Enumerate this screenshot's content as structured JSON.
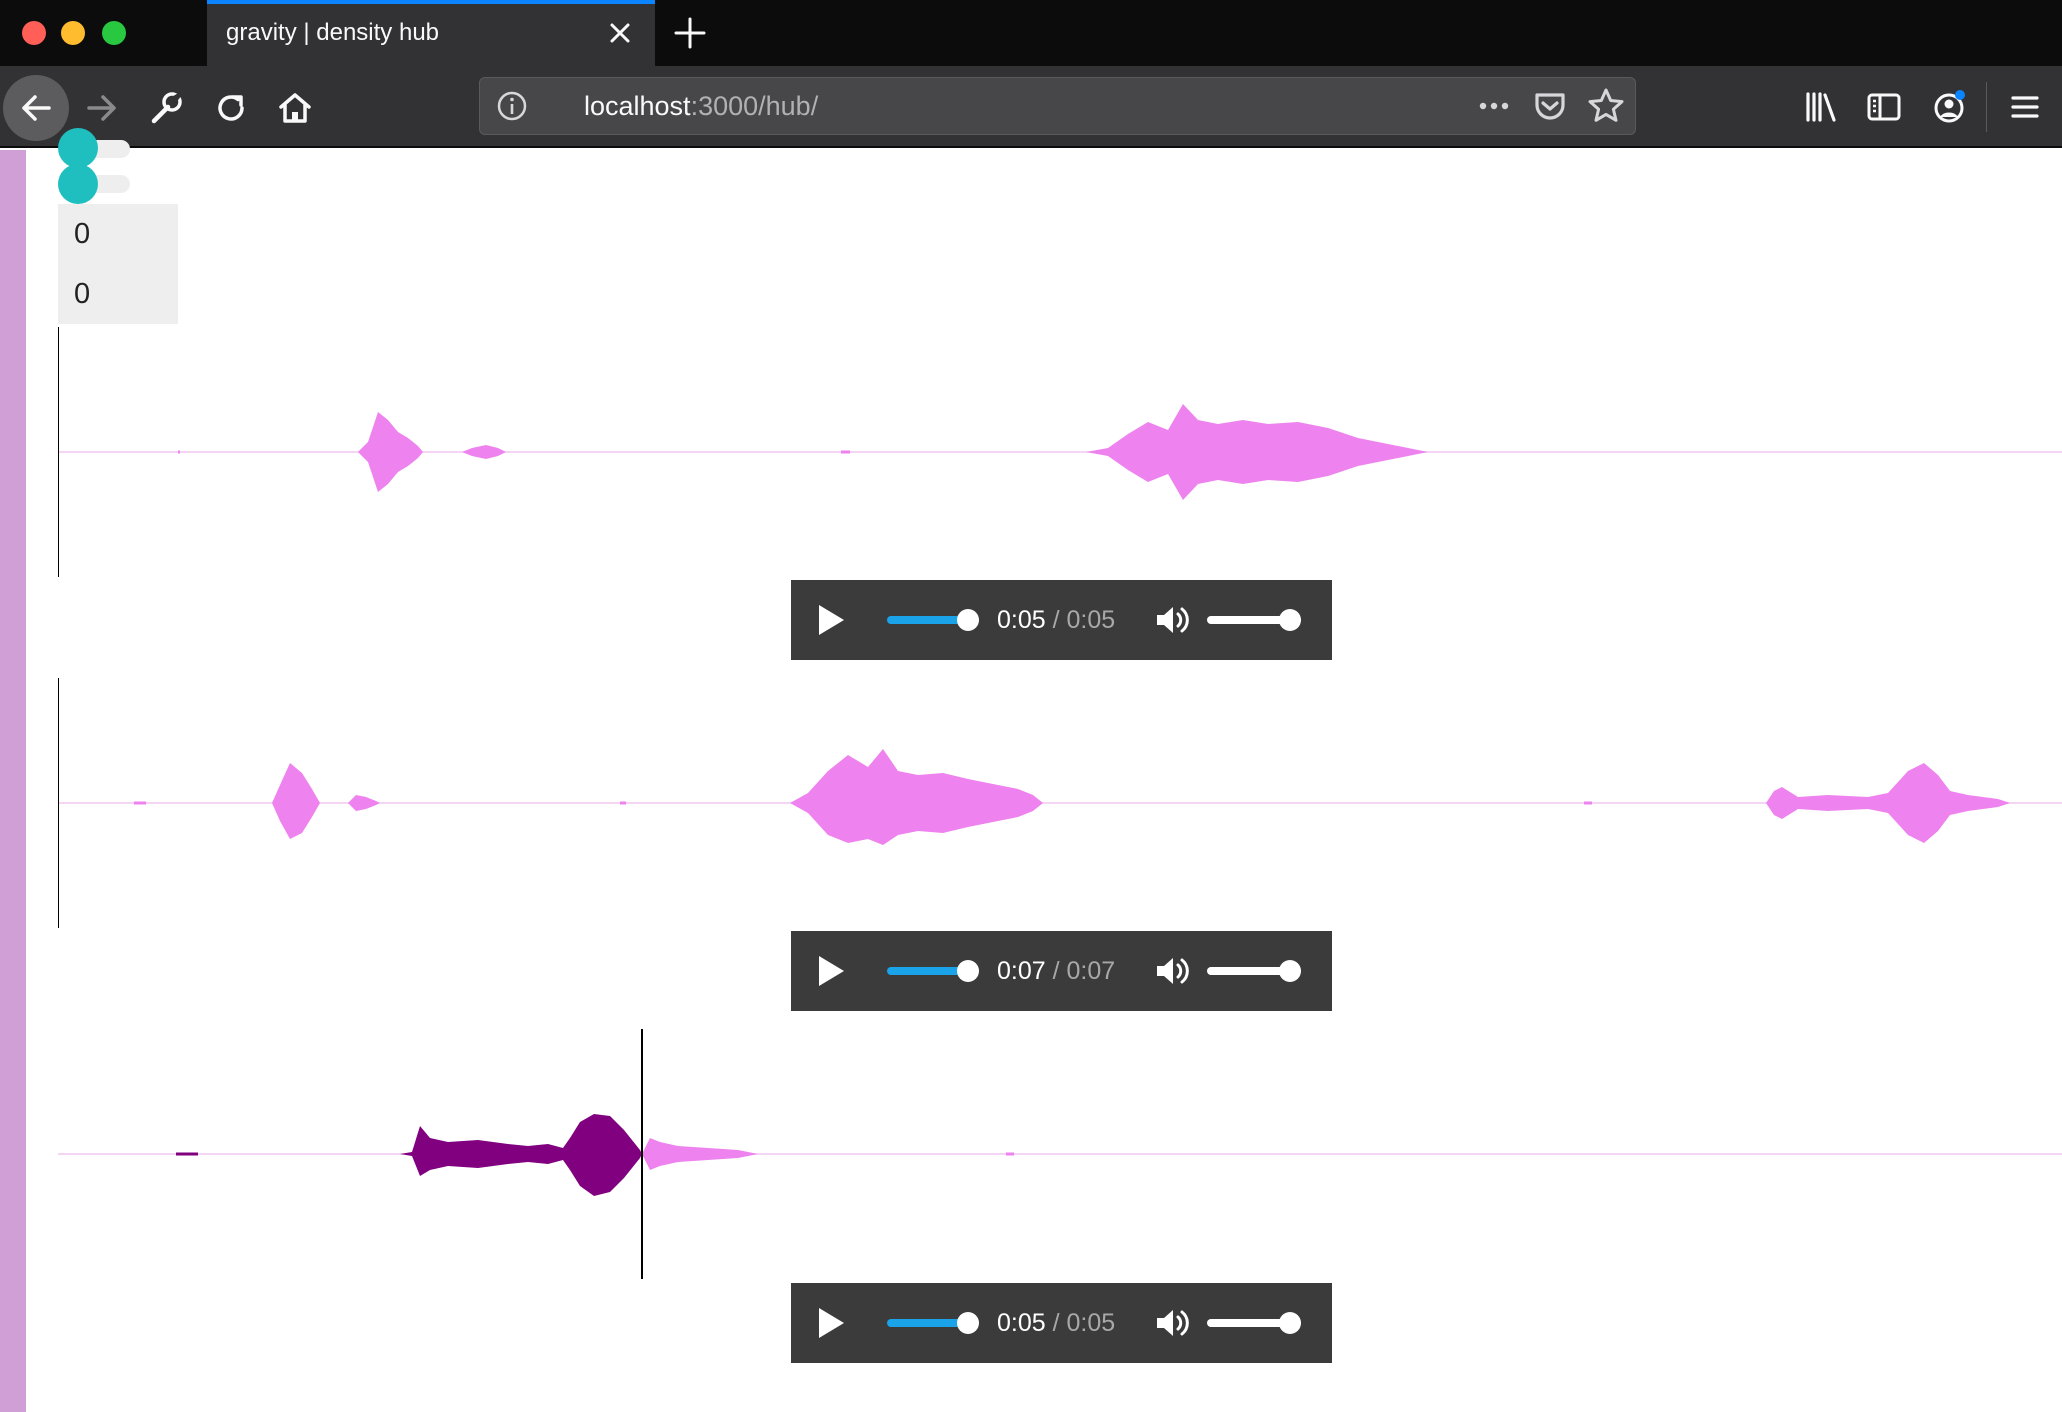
{
  "browser": {
    "tab_title": "gravity | density hub",
    "url_host": "localhost",
    "url_path": ":3000/hub/",
    "colors": {
      "accent": "#0a84ff",
      "close": "#ff5f57",
      "minimize": "#febc2e",
      "zoom": "#28c840"
    }
  },
  "page": {
    "colors": {
      "accent_bar": "#cf9fd6",
      "toggle": "#1fbfbf",
      "wave_unplayed": "#ee82ee",
      "wave_played": "#800080",
      "player_bg": "#3b3b3b",
      "seek": "#1aa3e8"
    },
    "counters": [
      "0",
      "0"
    ],
    "tracks": [
      {
        "current": "0:05",
        "duration": "0:05",
        "separator": "/",
        "progress": 1.0,
        "volume": 1.0,
        "playhead": 0.0
      },
      {
        "current": "0:07",
        "duration": "0:07",
        "separator": "/",
        "progress": 1.0,
        "volume": 1.0,
        "playhead": 0.0
      },
      {
        "current": "0:05",
        "duration": "0:05",
        "separator": "/",
        "progress": 1.0,
        "volume": 1.0,
        "playhead": 0.2916
      }
    ]
  }
}
